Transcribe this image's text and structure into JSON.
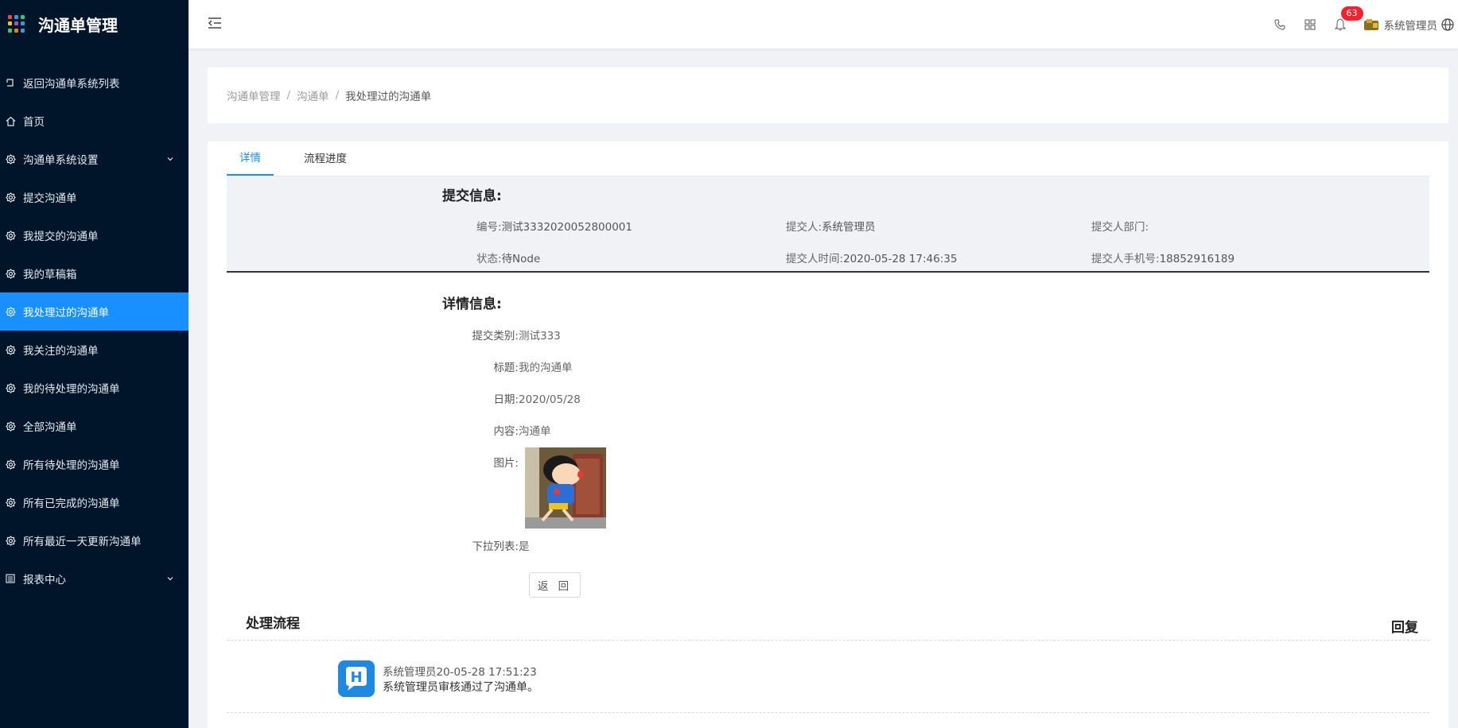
{
  "app": {
    "title": "沟通单管理"
  },
  "sidebar": {
    "items": [
      {
        "label": "返回沟通单系统列表",
        "icon": "return-icon"
      },
      {
        "label": "首页",
        "icon": "home-icon"
      },
      {
        "label": "沟通单系统设置",
        "icon": "gear-icon",
        "expandable": true
      },
      {
        "label": "提交沟通单",
        "icon": "gear-icon"
      },
      {
        "label": "我提交的沟通单",
        "icon": "gear-icon"
      },
      {
        "label": "我的草稿箱",
        "icon": "gear-icon"
      },
      {
        "label": "我处理过的沟通单",
        "icon": "gear-icon",
        "active": true
      },
      {
        "label": "我关注的沟通单",
        "icon": "gear-icon"
      },
      {
        "label": "我的待处理的沟通单",
        "icon": "gear-icon"
      },
      {
        "label": "全部沟通单",
        "icon": "gear-icon"
      },
      {
        "label": "所有待处理的沟通单",
        "icon": "gear-icon"
      },
      {
        "label": "所有已完成的沟通单",
        "icon": "gear-icon"
      },
      {
        "label": "所有最近一天更新沟通单",
        "icon": "gear-icon"
      },
      {
        "label": "报表中心",
        "icon": "report-icon",
        "expandable": true
      }
    ]
  },
  "header": {
    "notification_count": "63",
    "user_name": "系统管理员",
    "icons": [
      "phone-icon",
      "app-grid-icon",
      "bell-icon",
      "avatar",
      "globe-icon"
    ]
  },
  "breadcrumb": [
    "沟通单管理",
    "沟通单",
    "我处理过的沟通单"
  ],
  "tabs": [
    {
      "label": "详情",
      "active": true
    },
    {
      "label": "流程进度",
      "active": false
    }
  ],
  "submit_info": {
    "title": "提交信息:",
    "fields": [
      {
        "label": "编号:",
        "value": "测试3332020052800001"
      },
      {
        "label": "提交人:",
        "value": "系统管理员"
      },
      {
        "label": "提交人部门:",
        "value": ""
      },
      {
        "label": "状态:",
        "value": "待Node"
      },
      {
        "label": "提交人时间:",
        "value": "2020-05-28 17:46:35"
      },
      {
        "label": "提交人手机号:",
        "value": "18852916189"
      }
    ]
  },
  "detail_info": {
    "title": "详情信息:",
    "fields": [
      {
        "label": "提交类别:",
        "value": "测试333"
      },
      {
        "label": "标题:",
        "value": "我的沟通单"
      },
      {
        "label": "日期:",
        "value": "2020/05/28"
      },
      {
        "label": "内容:",
        "value": "沟通单"
      },
      {
        "label": "图片:",
        "value": ""
      },
      {
        "label": "下拉列表:",
        "value": "是"
      }
    ]
  },
  "back_button": "返 回",
  "process": {
    "title": "处理流程",
    "reply_title": "回复",
    "entries": [
      {
        "user": "系统管理员",
        "time": "2020-05-28 17:51:23",
        "name_overlap_text": "系统管理员20-05-28 17:51:23",
        "message": "系统管理员审核通过了沟通单。"
      }
    ]
  },
  "colors": {
    "sidebar_bg": "#001529",
    "active_bg": "#1890ff",
    "accent": "#1890ff",
    "badge": "#f5222d"
  }
}
